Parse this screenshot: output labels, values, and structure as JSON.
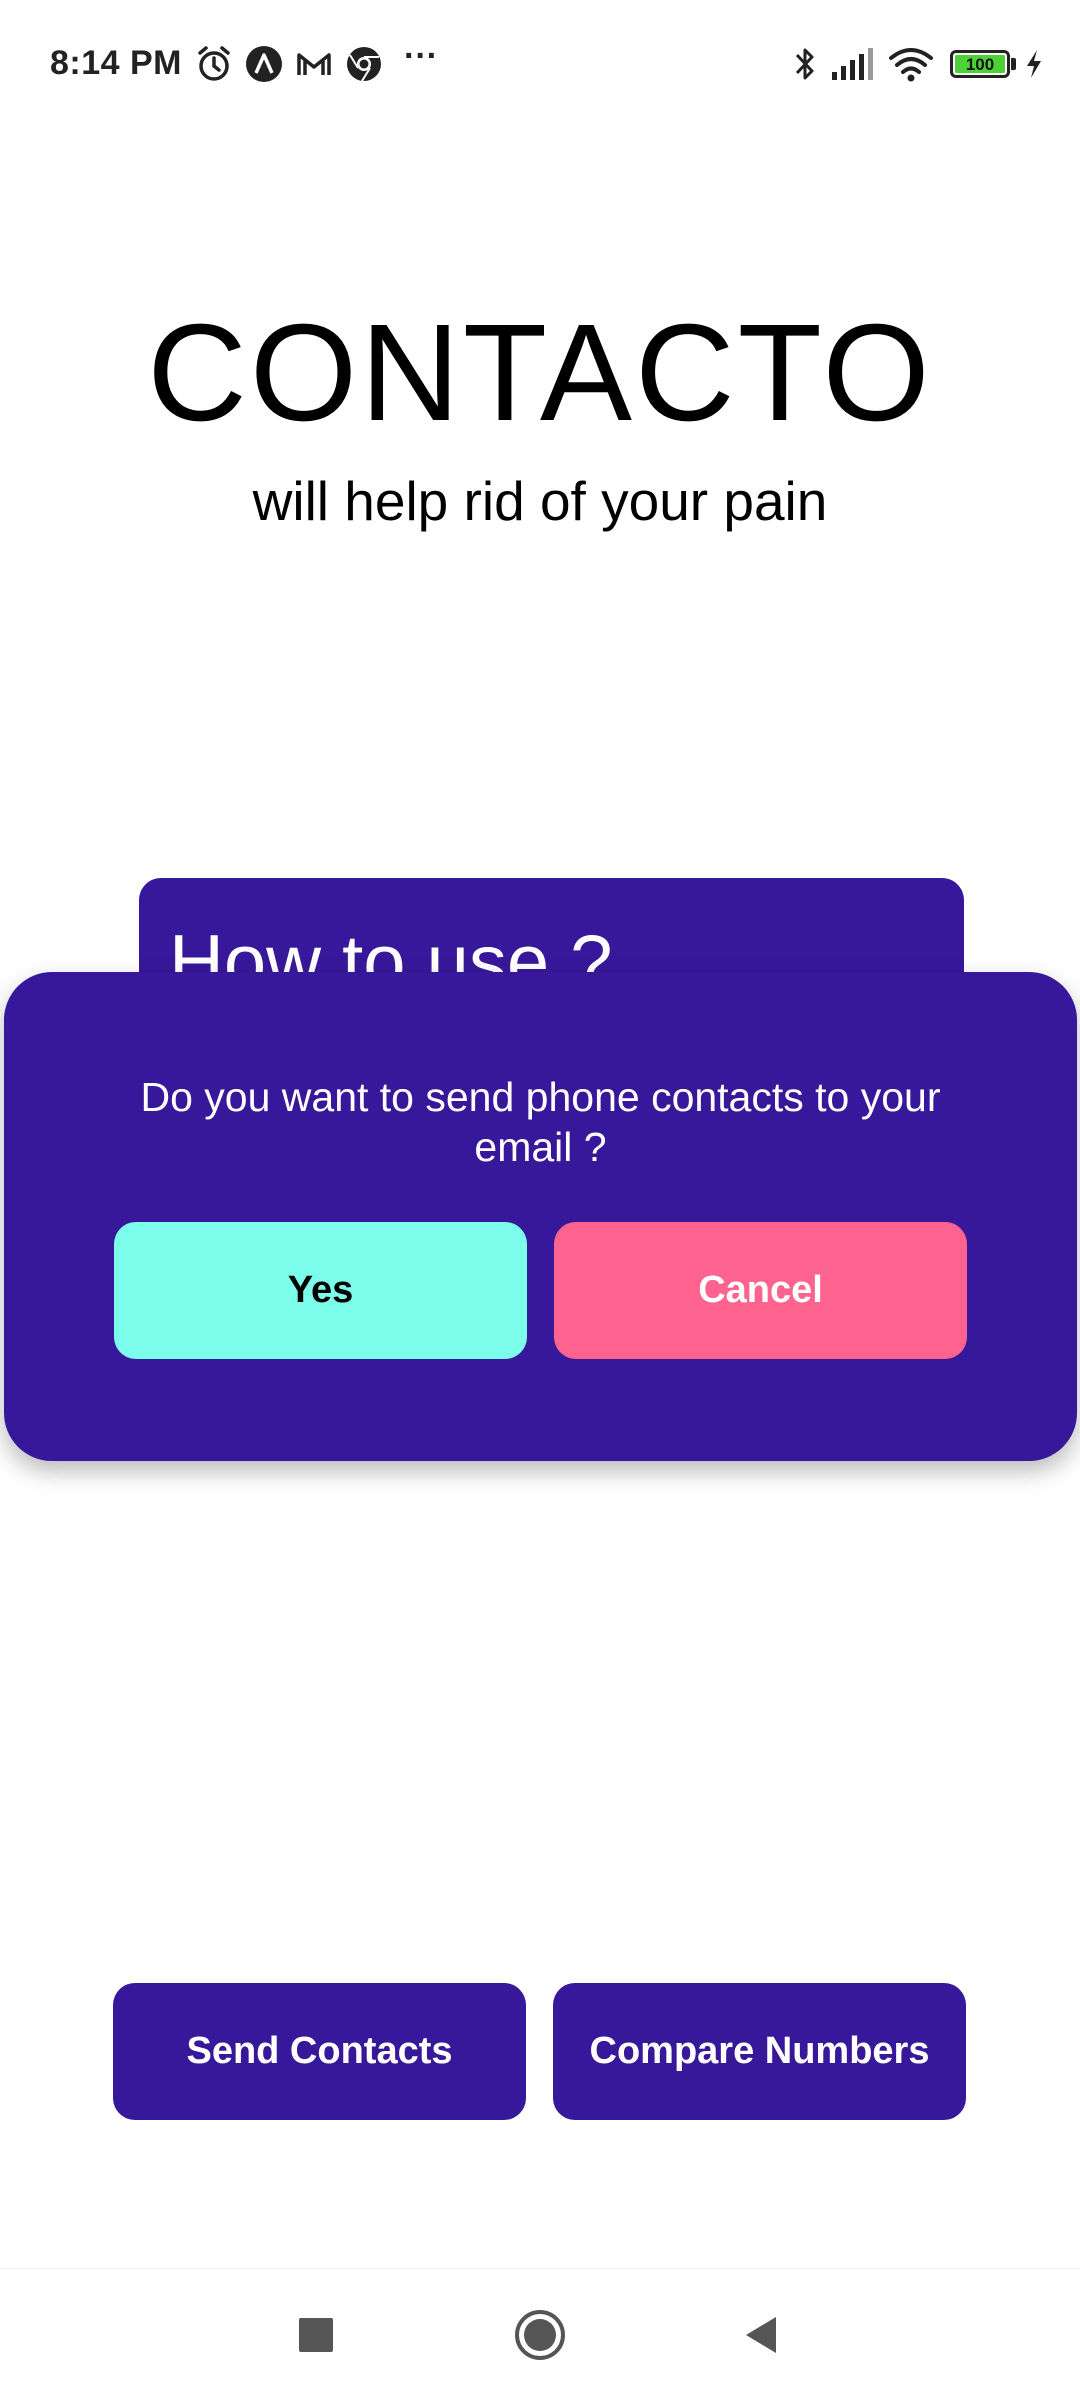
{
  "status_bar": {
    "time": "8:14 PM",
    "more_indicator": "···",
    "battery_level": "100",
    "left_icons": [
      "alarm-icon",
      "app-notification-icon",
      "gmail-icon",
      "chrome-icon"
    ],
    "right_icons": [
      "bluetooth-icon",
      "signal-icon",
      "wifi-icon",
      "battery-icon",
      "charging-icon"
    ]
  },
  "hero": {
    "title": "CONTACTO",
    "tagline": "will help rid of your pain"
  },
  "background_card": {
    "title": "How to use ?"
  },
  "dialog": {
    "message": "Do you want to send phone contacts to your email ?",
    "yes_label": "Yes",
    "cancel_label": "Cancel"
  },
  "actions": {
    "send_contacts_label": "Send Contacts",
    "compare_numbers_label": "Compare Numbers"
  },
  "nav_bar": {
    "buttons": [
      "recents-icon",
      "home-icon",
      "back-icon"
    ]
  },
  "colors": {
    "primary": "#38189a",
    "yes_button": "#7cfceb",
    "cancel_button": "#fe6390",
    "battery_fill": "#4cd137"
  }
}
